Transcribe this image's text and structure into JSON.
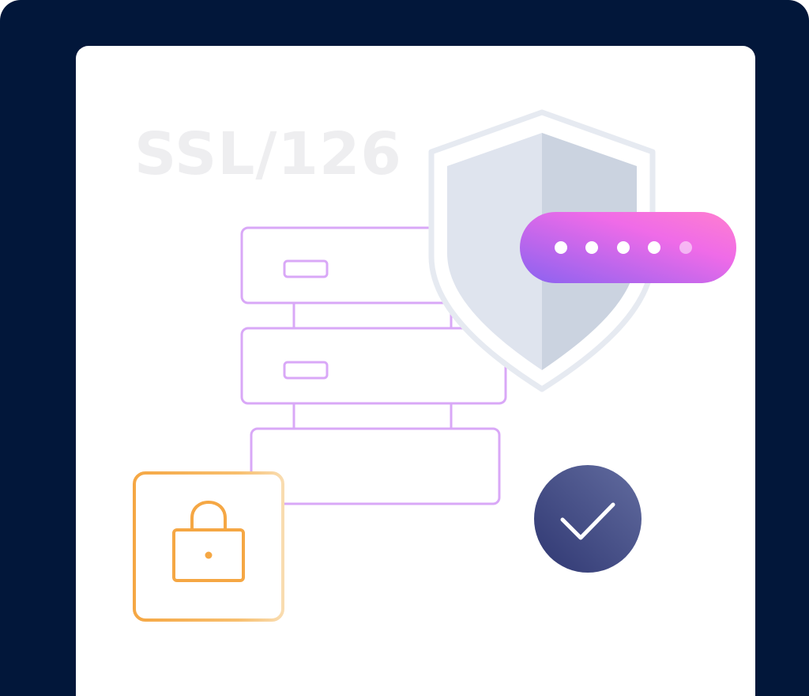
{
  "illustration": {
    "label": "SSL/126",
    "password_mask_dots": 5,
    "icons": [
      "server-rack-icon",
      "shield-icon",
      "password-field-icon",
      "lock-icon",
      "checkmark-icon"
    ]
  },
  "colors": {
    "frame_background": "#02173a",
    "panel_background": "#ffffff",
    "label_text": "#eeeef0",
    "server_outline": "#d9a8f7",
    "shield_light": "#dfe4ee",
    "shield_dark": "#cbd3e0",
    "password_gradient_start": "#8a62f0",
    "password_gradient_end": "#f76ce6",
    "lock_orange": "#f5a744",
    "check_circle_start": "#2f3772",
    "check_circle_end": "#5a6599"
  }
}
